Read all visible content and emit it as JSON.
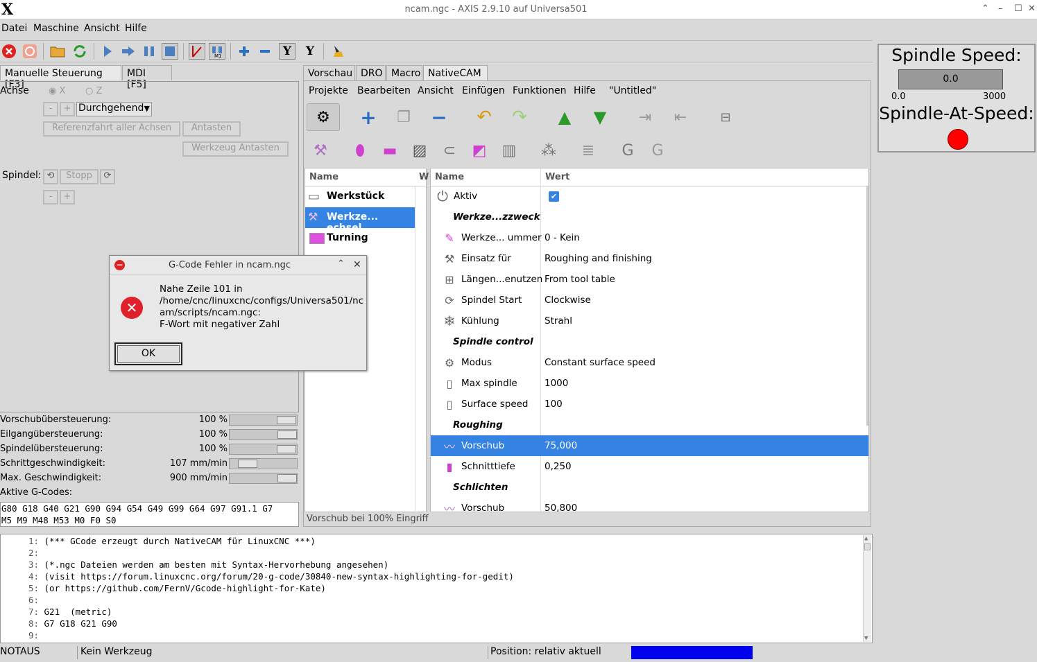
{
  "window": {
    "title": "ncam.ngc - AXIS 2.9.10 auf Universa501",
    "logo": "X"
  },
  "menu": [
    "Datei",
    "Maschine",
    "Ansicht",
    "Hilfe"
  ],
  "toolbar_icons": [
    "estop-icon",
    "power-icon",
    "open-icon",
    "reload-icon",
    "run-icon",
    "step-icon",
    "pause-icon",
    "stop-icon",
    "blockdelete-icon",
    "optional-stop-icon",
    "zoom-in-icon",
    "zoom-out-icon",
    "view-y-icon",
    "view-y2-icon",
    "clear-icon"
  ],
  "left_tabs": [
    "Manuelle Steuerung [F3]",
    "MDI [F5]"
  ],
  "manual": {
    "achse_label": "Achse",
    "axis_x": "X",
    "axis_z": "Z",
    "minus": "-",
    "plus": "+",
    "jog_mode": "Durchgehend",
    "home_all": "Referenzfahrt aller Achsen",
    "touch_off": "Antasten",
    "tool_touch": "Werkzeug Antasten",
    "spindle_label": "Spindel:",
    "spindle_stop": "Stopp"
  },
  "overrides": [
    {
      "label": "Vorschubübersteuerung:",
      "value": "100 %",
      "level": 0.7
    },
    {
      "label": "Eilgangübersteuerung:",
      "value": "100 %",
      "level": 0.71
    },
    {
      "label": "Spindelübersteuerung:",
      "value": "100 %",
      "level": 0.7
    },
    {
      "label": "Schrittgeschwindigkeit:",
      "value": "107 mm/min",
      "level": 0.12
    },
    {
      "label": "Max. Geschwindigkeit:",
      "value": "900 mm/min",
      "level": 0.71
    }
  ],
  "active_gcodes_label": "Aktive G-Codes:",
  "active_gcodes": [
    "G80 G18 G40 G21 G90 G94 G54 G49 G99 G64 G97 G91.1 G7",
    "M5 M9 M48 M53 M0 F0 S0"
  ],
  "right_tabs": [
    "Vorschau",
    "DRO",
    "Macro",
    "NativeCAM"
  ],
  "ncam": {
    "menu": [
      "Projekte",
      "Bearbeiten",
      "Ansicht",
      "Einfügen",
      "Funktionen",
      "Hilfe"
    ],
    "project": "\"Untitled\"",
    "tree_header": "Name",
    "tree_header2": "W",
    "tree_items": [
      "Werkstück",
      "Werkze... echsel",
      "Turning"
    ],
    "props_header_name": "Name",
    "props_header_value": "Wert",
    "rows": [
      {
        "type": "item",
        "icon": "power-icon",
        "name": "Aktiv",
        "value": ""
      },
      {
        "type": "section",
        "name": "Werkze...zzweck"
      },
      {
        "type": "item",
        "icon": "tool-icon",
        "name": "Werkze... ummer",
        "value": "0 - Kein"
      },
      {
        "type": "item",
        "icon": "tools-icon",
        "name": "Einsatz für",
        "value": "Roughing and finishing"
      },
      {
        "type": "item",
        "icon": "length-icon",
        "name": "Längen...enutzen",
        "value": "From tool table"
      },
      {
        "type": "item",
        "icon": "spindle-icon",
        "name": "Spindel Start",
        "value": "Clockwise"
      },
      {
        "type": "item",
        "icon": "snowflake-icon",
        "name": "Kühlung",
        "value": "Strahl"
      },
      {
        "type": "section",
        "name": "Spindle control"
      },
      {
        "type": "item",
        "icon": "mode-icon",
        "name": "Modus",
        "value": "Constant surface speed"
      },
      {
        "type": "item",
        "icon": "spindle-max-icon",
        "name": "Max spindle",
        "value": "1000"
      },
      {
        "type": "item",
        "icon": "surface-speed-icon",
        "name": "Surface speed",
        "value": "100"
      },
      {
        "type": "section",
        "name": "Roughing"
      },
      {
        "type": "item",
        "icon": "feed-icon",
        "name": "Vorschub",
        "value": "75,000",
        "selected": true
      },
      {
        "type": "item",
        "icon": "depth-icon",
        "name": "Schnitttiefe",
        "value": "0,250"
      },
      {
        "type": "section",
        "name": "Schlichten"
      },
      {
        "type": "item",
        "icon": "feed-icon",
        "name": "Vorschub",
        "value": "50,800"
      }
    ],
    "hint": "Vorschub bei 100% Eingriff"
  },
  "editor_lines": [
    {
      "n": "1:",
      "t": "(*** GCode erzeugt durch NativeCAM für LinuxCNC ***)"
    },
    {
      "n": "2:",
      "t": ""
    },
    {
      "n": "3:",
      "t": "(*.ngc Dateien werden am besten mit Syntax-Hervorhebung angesehen)"
    },
    {
      "n": "4:",
      "t": "(visit https://forum.linuxcnc.org/forum/20-g-code/30840-new-syntax-highlighting-for-gedit)"
    },
    {
      "n": "5:",
      "t": "(or https://github.com/FernV/Gcode-highlight-for-Kate)"
    },
    {
      "n": "6:",
      "t": ""
    },
    {
      "n": "7:",
      "t": "G21  (metric)"
    },
    {
      "n": "8:",
      "t": "G7 G18 G21 G90"
    },
    {
      "n": "9:",
      "t": ""
    }
  ],
  "status": {
    "estop": "NOTAUS",
    "tool": "Kein Werkzeug",
    "position": "Position: relativ aktuell",
    "bar_color": "#0000ee"
  },
  "spindle": {
    "speed_label": "Spindle Speed:",
    "speed_value": "0.0",
    "min": "0.0",
    "max": "3000",
    "at_speed_label": "Spindle-At-Speed:",
    "led_color": "#ff0000"
  },
  "dialog": {
    "title": "G-Code Fehler in ncam.ngc",
    "message_lines": [
      "Nahe Zeile 101 in",
      "/home/cnc/linuxcnc/configs/Universa501/nc",
      "am/scripts/ncam.ngc:",
      "F-Wort mit negativer Zahl"
    ],
    "ok": "OK"
  }
}
